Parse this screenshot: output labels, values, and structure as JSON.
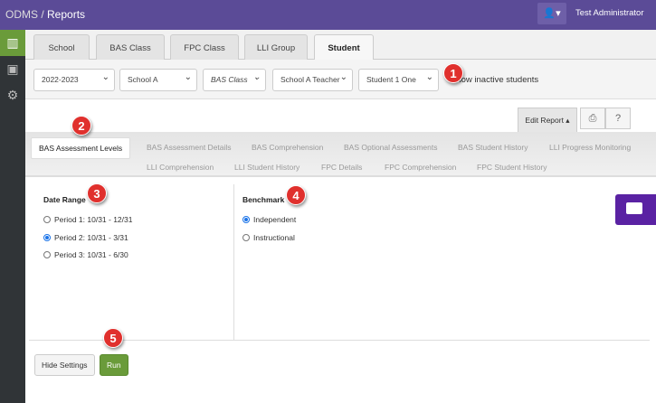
{
  "header": {
    "app": "ODMS",
    "separator": " / ",
    "page": "Reports",
    "user": "Test Administrator",
    "user_icon": "user-icon"
  },
  "sidebar": {
    "items": [
      {
        "icon": "chart-icon"
      },
      {
        "icon": "contact-card-icon"
      },
      {
        "icon": "gear-icon"
      }
    ],
    "active_color": "#6a9b3a"
  },
  "tabs": [
    "School",
    "BAS Class",
    "FPC Class",
    "LLI Group",
    "Student"
  ],
  "active_tab": "Student",
  "filters": {
    "year": "2022-2023",
    "school": "School A",
    "class": "BAS Class",
    "teacher": "School A Teacher",
    "student": "Student 1 One",
    "show_inactive_label": "Show inactive students"
  },
  "toolbar": {
    "edit_report": "Edit Report ▴",
    "print_icon": "print-icon",
    "help_icon": "help-icon"
  },
  "report_tabs": {
    "row1": [
      "BAS Assessment Levels",
      "BAS Assessment Details",
      "BAS Comprehension",
      "BAS Optional Assessments",
      "BAS Student History",
      "LLI Progress Monitoring"
    ],
    "row2": [
      "LLI Comprehension",
      "LLI Student History",
      "FPC Details",
      "FPC Comprehension",
      "FPC Student History"
    ],
    "active": "BAS Assessment Levels"
  },
  "settings": {
    "date_range": {
      "label": "Date Range",
      "options": [
        "Period 1: 10/31 - 12/31",
        "Period 2: 10/31 - 3/31",
        "Period 3: 10/31 - 6/30"
      ],
      "selected": 1
    },
    "benchmark": {
      "label": "Benchmark",
      "options": [
        "Independent",
        "Instructional"
      ],
      "selected": 0
    }
  },
  "buttons": {
    "hide": "Hide Settings",
    "run": "Run"
  },
  "badges": [
    "1",
    "2",
    "3",
    "4",
    "5"
  ],
  "colors": {
    "header": "#5b4b97",
    "badge": "#e0302d",
    "chat": "#5a22a3"
  }
}
